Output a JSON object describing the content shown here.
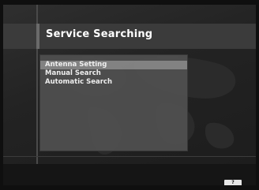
{
  "header": {
    "title": "Service Searching"
  },
  "menu": {
    "items": [
      {
        "label": "Antenna Setting",
        "selected": true
      },
      {
        "label": "Manual Search",
        "selected": false
      },
      {
        "label": "Automatic Search",
        "selected": false
      }
    ]
  },
  "footer": {
    "help_key_label": "?"
  },
  "colors": {
    "background": "#1c1c1c",
    "panel": "#505050",
    "selected_row": "#8a8a8a",
    "text": "#ffffff"
  }
}
